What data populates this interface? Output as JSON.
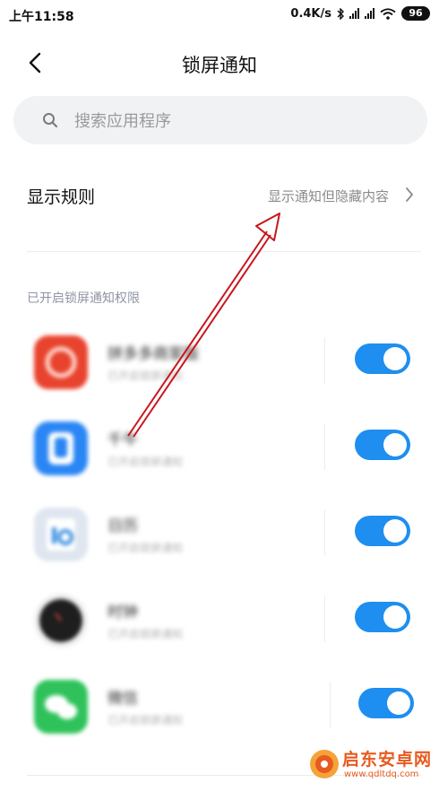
{
  "status_bar": {
    "time": "上午11:58",
    "speed": "0.4K/s",
    "battery": "96"
  },
  "header": {
    "title": "锁屏通知"
  },
  "search": {
    "placeholder": "搜索应用程序"
  },
  "display_rule": {
    "label": "显示规则",
    "value": "显示通知但隐藏内容"
  },
  "section": {
    "label": "已开启锁屏通知权限"
  },
  "apps": [
    {
      "name": "拼多多商家版",
      "subtitle": "已开启锁屏通知",
      "enabled": true,
      "icon": "pinduoduo-icon",
      "color": "#e8432e"
    },
    {
      "name": "千牛",
      "subtitle": "已开启锁屏通知",
      "enabled": true,
      "icon": "qianniu-icon",
      "color": "#2a86f4"
    },
    {
      "name": "日历",
      "subtitle": "已开启锁屏通知",
      "enabled": true,
      "icon": "calendar-icon",
      "color": "#dfe6ef"
    },
    {
      "name": "时钟",
      "subtitle": "已开启锁屏通知",
      "enabled": true,
      "icon": "clock-icon",
      "color": "#1e1e1e"
    },
    {
      "name": "微信",
      "subtitle": "已开启锁屏通知",
      "enabled": true,
      "icon": "wechat-icon",
      "color": "#2fc25b"
    }
  ],
  "watermark": {
    "title": "启东安卓网",
    "url": "www.qdltdq.com"
  },
  "accent_color": "#1e8ef0",
  "annotation_color": "#c8161d"
}
